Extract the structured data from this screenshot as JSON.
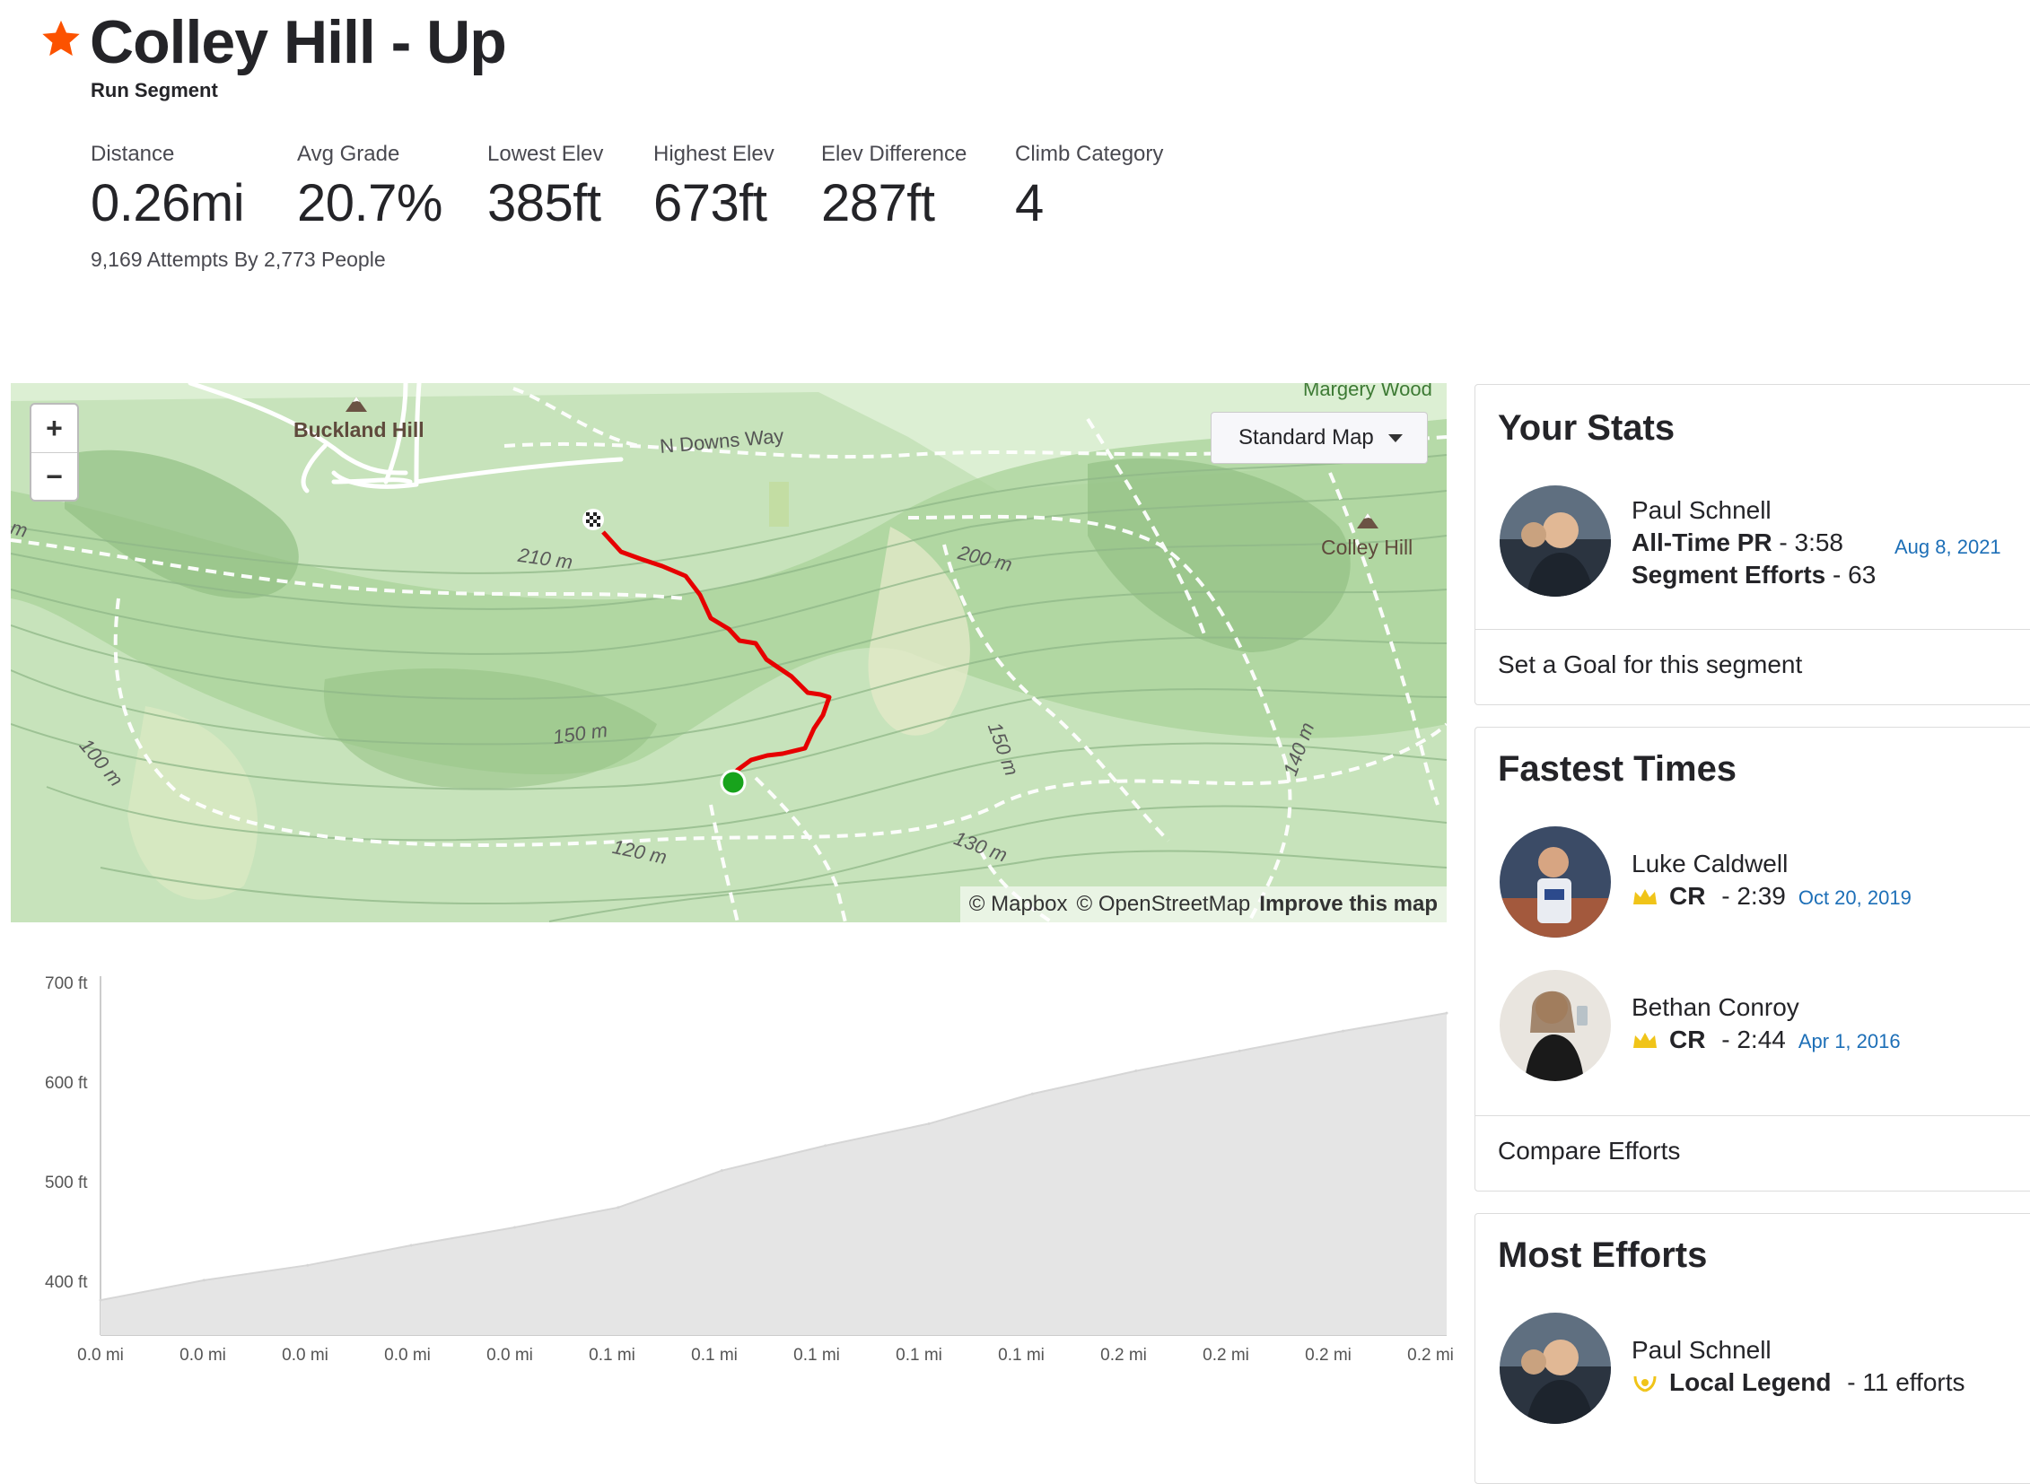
{
  "header": {
    "title": "Colley Hill - Up",
    "subtitle": "Run Segment",
    "attempts": "9,169 Attempts By 2,773 People"
  },
  "stats": [
    {
      "label": "Distance",
      "value": "0.26mi"
    },
    {
      "label": "Avg Grade",
      "value": "20.7%"
    },
    {
      "label": "Lowest Elev",
      "value": "385ft"
    },
    {
      "label": "Highest Elev",
      "value": "673ft"
    },
    {
      "label": "Elev Difference",
      "value": "287ft"
    },
    {
      "label": "Climb Category",
      "value": "4"
    }
  ],
  "map": {
    "zoom_in": "+",
    "zoom_out": "−",
    "style_select": "Standard Map",
    "attribution": {
      "mapbox": "© Mapbox",
      "osm": "© OpenStreetMap",
      "improve": "Improve this map"
    },
    "labels": {
      "buckland": "Buckland Hill",
      "colley": "Colley Hill",
      "downs": "N Downs Way",
      "margery": "Margery Wood",
      "c210": "210 m",
      "c200": "200 m",
      "c150a": "150 m",
      "c150b": "150 m",
      "c140": "140 m",
      "c130": "130 m",
      "c120": "120 m",
      "c100": "100 m",
      "cm": "m"
    }
  },
  "elevation_chart": {
    "y_ticks": [
      "700 ft",
      "600 ft",
      "500 ft",
      "400 ft"
    ],
    "x_ticks": [
      "0.0 mi",
      "0.0 mi",
      "0.0 mi",
      "0.0 mi",
      "0.0 mi",
      "0.1 mi",
      "0.1 mi",
      "0.1 mi",
      "0.1 mi",
      "0.1 mi",
      "0.2 mi",
      "0.2 mi",
      "0.2 mi",
      "0.2 mi"
    ]
  },
  "chart_data": {
    "type": "area",
    "title": "",
    "xlabel": "",
    "ylabel": "",
    "x": [
      0,
      0.02,
      0.04,
      0.06,
      0.08,
      0.1,
      0.12,
      0.14,
      0.16,
      0.18,
      0.2,
      0.22,
      0.24,
      0.26
    ],
    "series": [
      {
        "values": [
          385,
          405,
          420,
          440,
          458,
          478,
          515,
          540,
          562,
          592,
          615,
          635,
          655,
          673
        ]
      }
    ],
    "ylim": [
      350,
      710
    ],
    "grid": false
  },
  "your_stats": {
    "title": "Your Stats",
    "name": "Paul Schnell",
    "pr_label": "All-Time PR",
    "pr_value": "- 3:58",
    "pr_date": "Aug 8, 2021",
    "efforts_label": "Segment Efforts",
    "efforts_value": "- 63",
    "goal_link": "Set a Goal for this segment"
  },
  "fastest_times": {
    "title": "Fastest Times",
    "entries": [
      {
        "name": "Luke Caldwell",
        "badge": "CR",
        "time": "- 2:39",
        "date": "Oct 20, 2019"
      },
      {
        "name": "Bethan Conroy",
        "badge": "CR",
        "time": "- 2:44",
        "date": "Apr 1, 2016"
      }
    ],
    "compare_link": "Compare Efforts"
  },
  "most_efforts": {
    "title": "Most Efforts",
    "name": "Paul Schnell",
    "badge": "Local Legend",
    "count": "- 11 efforts"
  },
  "colors": {
    "brand": "#fc5200",
    "route": "#e60000",
    "link": "#1d6fb7",
    "crown": "#f0c419"
  }
}
